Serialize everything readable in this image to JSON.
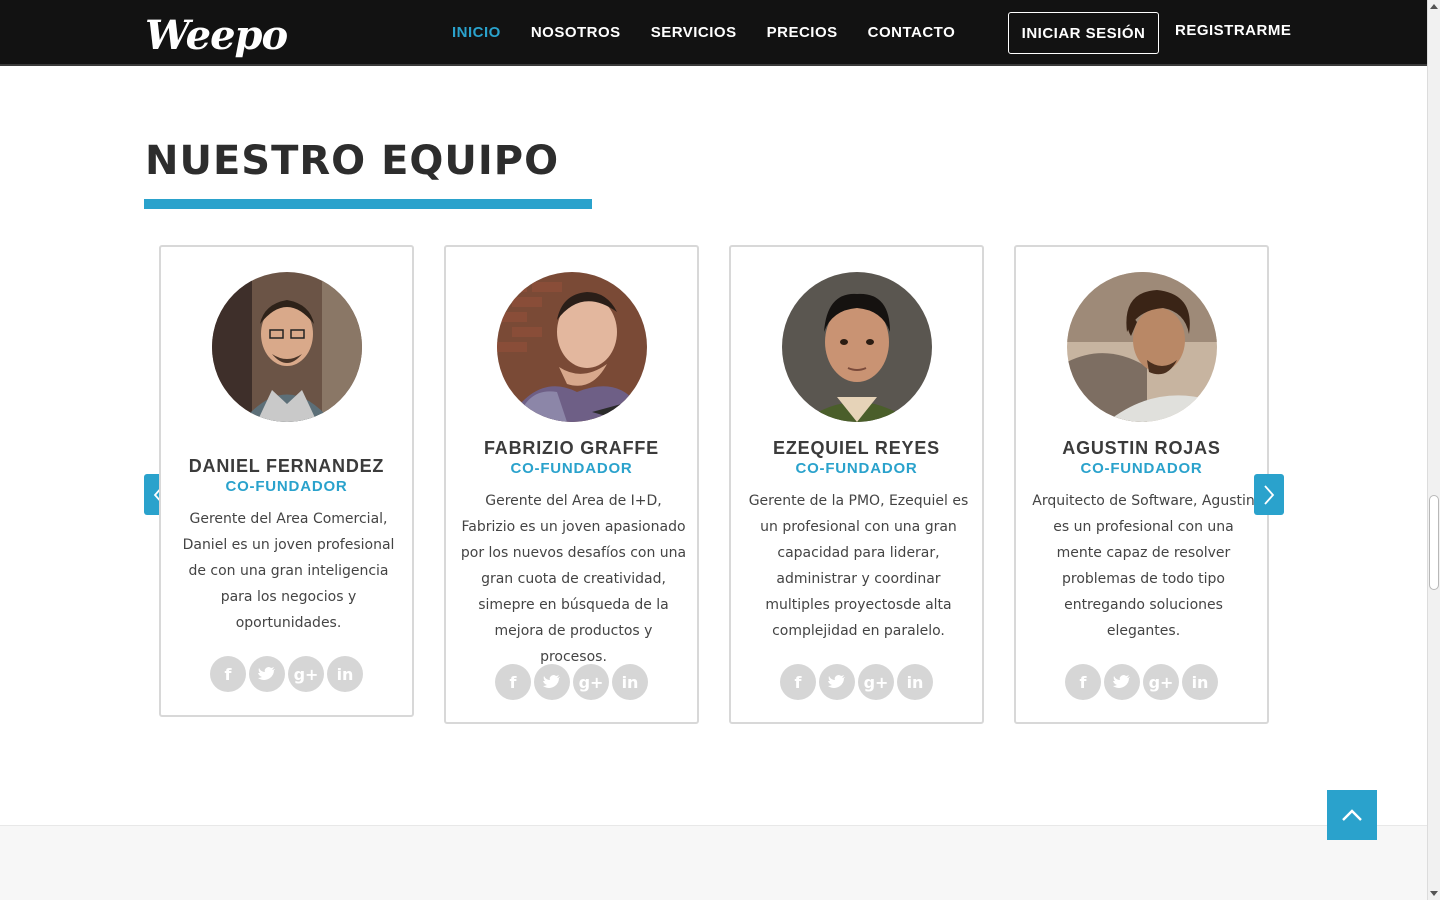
{
  "brand": {
    "logo_text": "Weepo"
  },
  "nav": {
    "items": [
      {
        "label": "INICIO",
        "active": true
      },
      {
        "label": "NOSOTROS",
        "active": false
      },
      {
        "label": "SERVICIOS",
        "active": false
      },
      {
        "label": "PRECIOS",
        "active": false
      },
      {
        "label": "CONTACTO",
        "active": false
      }
    ],
    "login_label": "INICIAR SESIÓN",
    "register_label": "REGISTRARME"
  },
  "section": {
    "title": "NUESTRO EQUIPO"
  },
  "team": [
    {
      "name": "DANIEL FERNANDEZ",
      "role": "CO-FUNDADOR",
      "bio": "Gerente del Area Comercial, Daniel es un joven profesional de con una gran inteligencia para los negocios y oportunidades."
    },
    {
      "name": "FABRIZIO GRAFFE",
      "role": "CO-FUNDADOR",
      "bio": "Gerente del Area de I+D, Fabrizio es un joven apasionado por los nuevos desafíos con una gran cuota de creatividad, simepre en búsqueda de la mejora de productos y procesos."
    },
    {
      "name": "EZEQUIEL REYES",
      "role": "CO-FUNDADOR",
      "bio": "Gerente de la PMO, Ezequiel es un profesional con una gran capacidad para liderar, administrar y coordinar multiples proyectosde alta complejidad en paralelo."
    },
    {
      "name": "AGUSTIN ROJAS",
      "role": "CO-FUNDADOR",
      "bio": "Arquitecto de Software, Agustin es un profesional con una mente capaz de resolver problemas de todo tipo entregando soluciones elegantes."
    }
  ],
  "social_icons": [
    {
      "name": "facebook-icon",
      "glyph": "f"
    },
    {
      "name": "twitter-icon",
      "glyph": "t"
    },
    {
      "name": "google-plus-icon",
      "glyph": "g+"
    },
    {
      "name": "linkedin-icon",
      "glyph": "in"
    }
  ],
  "colors": {
    "accent": "#2aa2cc",
    "navbar_bg": "#121212",
    "social_bg": "#d6d6d6",
    "title_text": "#2d2d2d"
  }
}
